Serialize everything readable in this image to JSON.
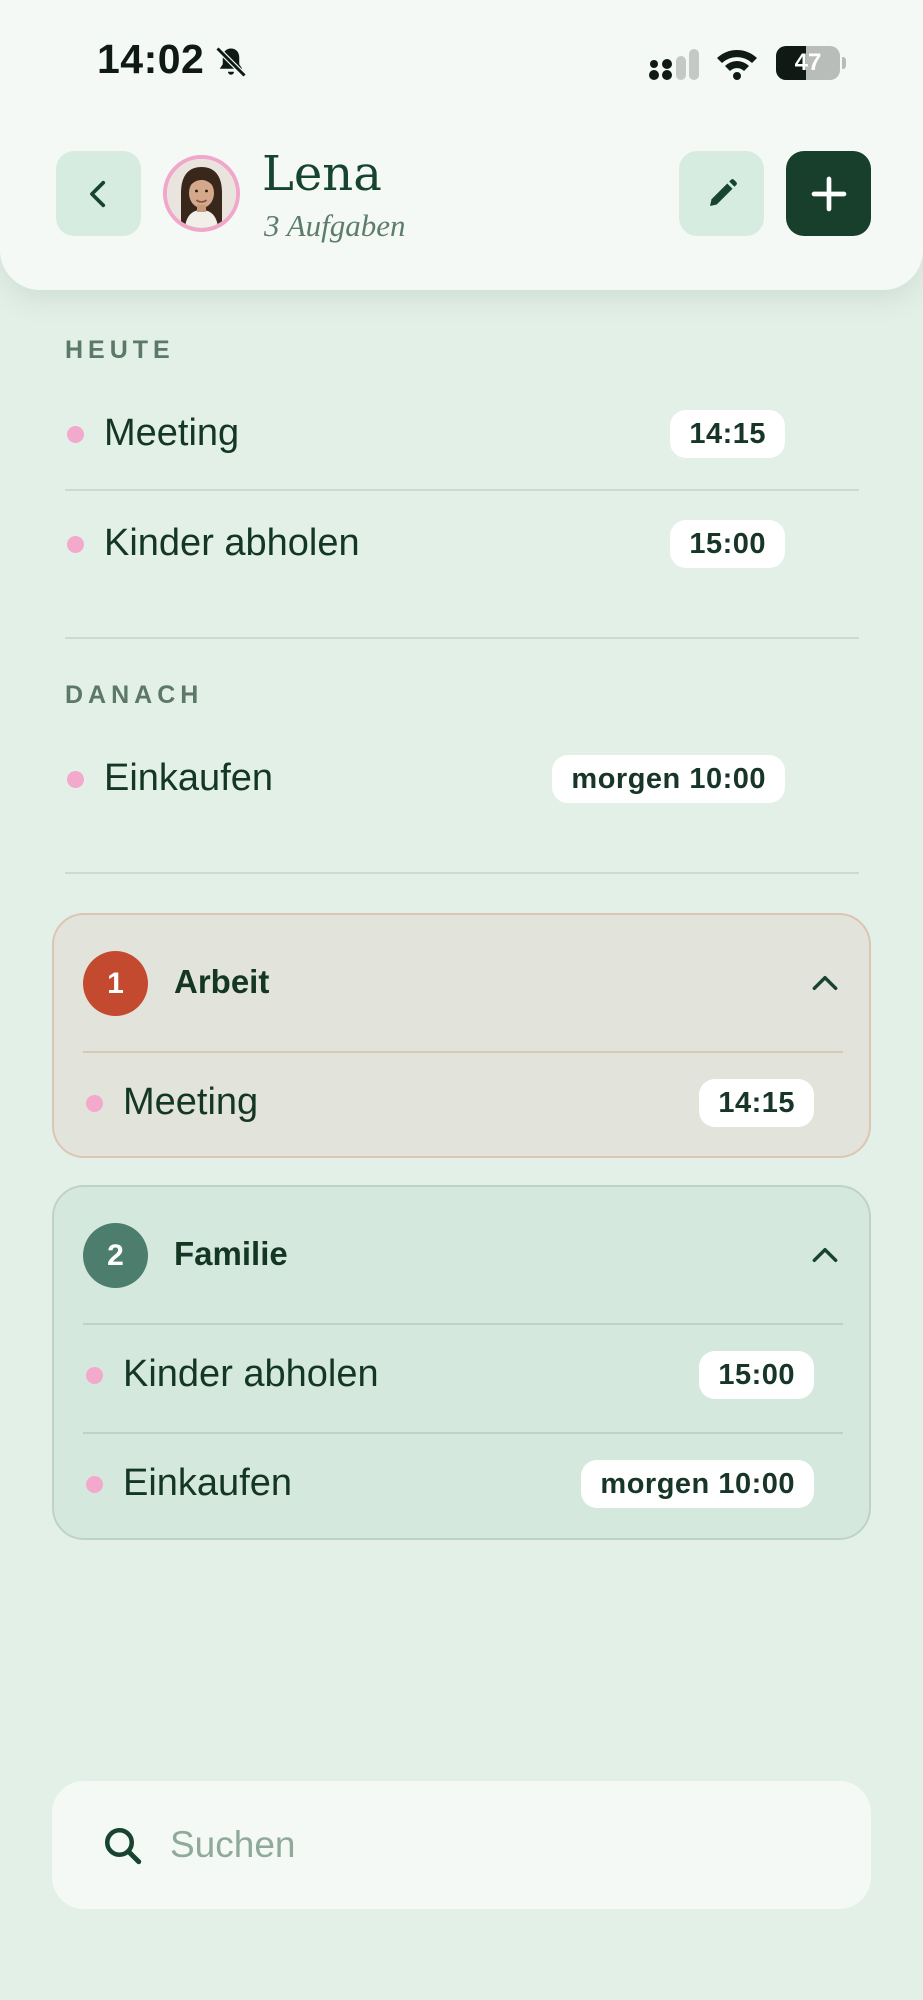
{
  "status_bar": {
    "time": "14:02",
    "battery": "47",
    "battery_level_percent": 47
  },
  "header": {
    "name": "Lena",
    "subtitle": "3 Aufgaben",
    "icons": [
      "chevron-left-icon",
      "pencil-icon",
      "plus-icon"
    ]
  },
  "sections": {
    "today": {
      "label": "HEUTE",
      "items": [
        {
          "title": "Meeting",
          "time": "14:15"
        },
        {
          "title": "Kinder abholen",
          "time": "15:00"
        }
      ]
    },
    "later": {
      "label": "DANACH",
      "items": [
        {
          "title": "Einkaufen",
          "time": "morgen 10:00"
        }
      ]
    }
  },
  "groups": [
    {
      "badge": "1",
      "title": "Arbeit",
      "badge_color": "#c44a2f",
      "items": [
        {
          "title": "Meeting",
          "time": "14:15"
        }
      ]
    },
    {
      "badge": "2",
      "title": "Familie",
      "badge_color": "#4c7d6d",
      "items": [
        {
          "title": "Kinder abholen",
          "time": "15:00"
        },
        {
          "title": "Einkaufen",
          "time": "morgen 10:00"
        }
      ]
    }
  ],
  "search": {
    "placeholder": "Suchen"
  },
  "colors": {
    "background": "#e3f0e8",
    "accent_dark": "#173f2b",
    "dot_pink": "#f3a9cc"
  }
}
